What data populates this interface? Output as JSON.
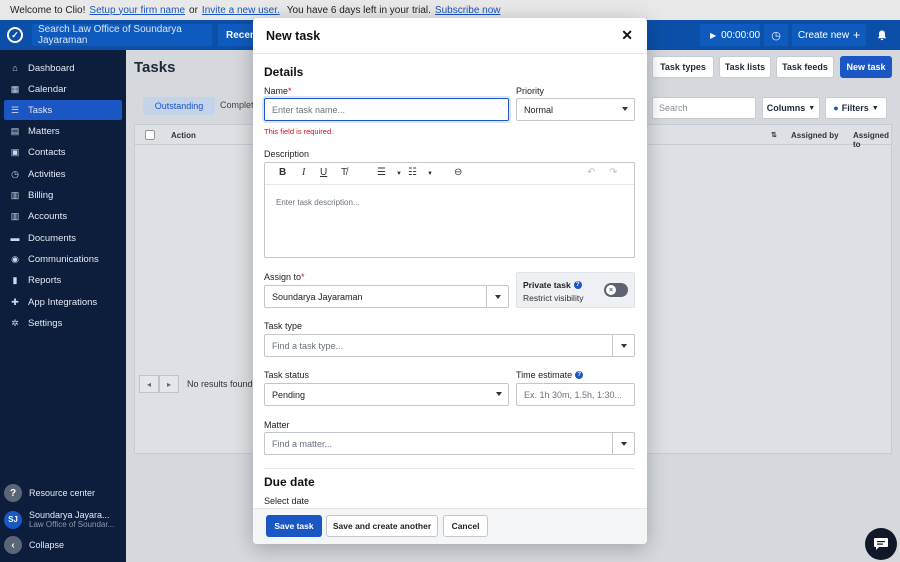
{
  "banner": {
    "prefix": "Welcome to Clio!",
    "setup_link": "Setup your firm name",
    "or": "or",
    "invite_link": "Invite a new user.",
    "trial_text": "You have 6 days left in your trial.",
    "subscribe_link": "Subscribe now"
  },
  "topbar": {
    "search_placeholder": "Search Law Office of Soundarya Jayaraman",
    "recent_label": "Recent",
    "timer": "00:00:00",
    "create_new": "Create new"
  },
  "sidebar": {
    "items": [
      {
        "label": "Dashboard",
        "icon": "home-icon"
      },
      {
        "label": "Calendar",
        "icon": "calendar-icon"
      },
      {
        "label": "Tasks",
        "icon": "tasks-icon"
      },
      {
        "label": "Matters",
        "icon": "briefcase-icon"
      },
      {
        "label": "Contacts",
        "icon": "contacts-icon"
      },
      {
        "label": "Activities",
        "icon": "clock-icon"
      },
      {
        "label": "Billing",
        "icon": "billing-icon"
      },
      {
        "label": "Accounts",
        "icon": "bank-icon"
      },
      {
        "label": "Documents",
        "icon": "folder-icon"
      },
      {
        "label": "Communications",
        "icon": "chat-icon"
      },
      {
        "label": "Reports",
        "icon": "chart-icon"
      },
      {
        "label": "App Integrations",
        "icon": "puzzle-icon"
      },
      {
        "label": "Settings",
        "icon": "gear-icon"
      }
    ],
    "resource_center": "Resource center",
    "user_initials": "SJ",
    "user_name": "Soundarya Jayara...",
    "user_firm": "Law Office of Soundar...",
    "collapse": "Collapse"
  },
  "page": {
    "title": "Tasks",
    "buttons": {
      "task_types": "Task types",
      "task_lists": "Task lists",
      "task_feeds": "Task feeds",
      "new_task": "New task"
    },
    "tab_outstanding": "Outstanding",
    "tab_completed": "Complete",
    "search_placeholder": "Search",
    "columns": "Columns",
    "filters": "Filters",
    "col_action": "Action",
    "col_assigned_by": "Assigned by",
    "col_assigned_to": "Assigned to",
    "no_results": "No results found"
  },
  "modal": {
    "title": "New task",
    "details": "Details",
    "name_label": "Name",
    "name_placeholder": "Enter task name...",
    "name_error": "This field is required.",
    "priority_label": "Priority",
    "priority_value": "Normal",
    "description_label": "Description",
    "description_placeholder": "Enter task description...",
    "assign_label": "Assign to",
    "assign_value": "Soundarya Jayaraman",
    "private_title": "Private task",
    "private_sub": "Restrict visibility",
    "task_type_label": "Task type",
    "task_type_placeholder": "Find a task type...",
    "status_label": "Task status",
    "status_value": "Pending",
    "time_label": "Time estimate",
    "time_placeholder": "Ex. 1h 30m, 1.5h, 1:30...",
    "matter_label": "Matter",
    "matter_placeholder": "Find a matter...",
    "due_date": "Due date",
    "select_date": "Select date",
    "save": "Save task",
    "save_another": "Save and create another",
    "cancel": "Cancel"
  },
  "colors": {
    "brand": "#0b4fa8",
    "primary": "#1a56c4",
    "sidebar": "#0d1e3d",
    "error": "#c4161c"
  }
}
